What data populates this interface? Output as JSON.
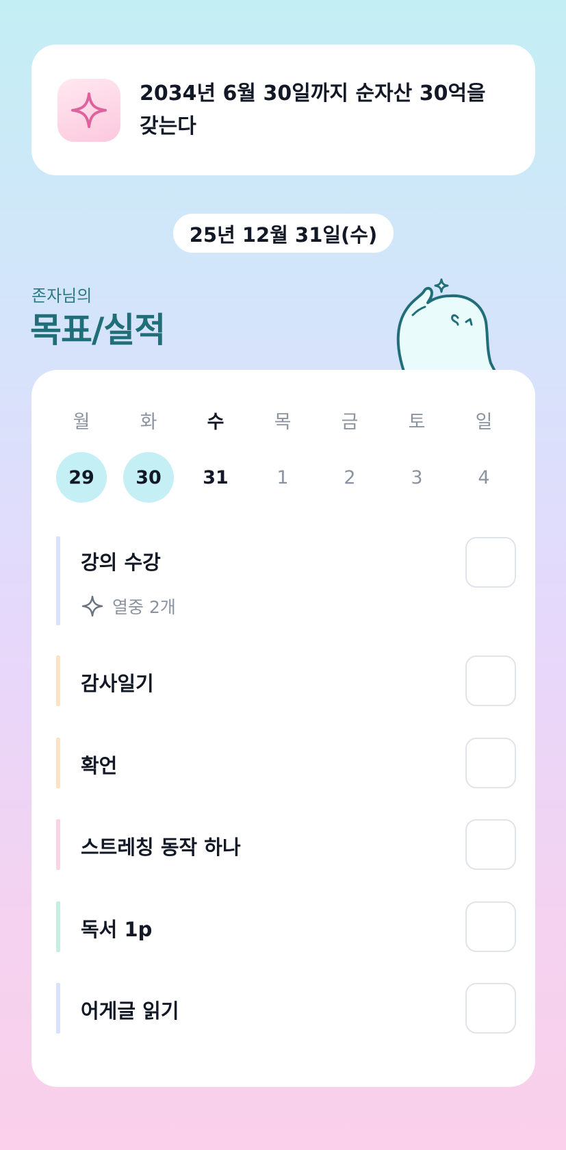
{
  "goal": {
    "text": "2034년 6월 30일까지 순자산 30억을 갖는다",
    "icon": "sparkle-icon"
  },
  "date": "25년 12월 31일(수)",
  "section": {
    "owner": "존자님의",
    "title": "목표/실적"
  },
  "week": [
    {
      "day": "월",
      "date": "29",
      "state": "done"
    },
    {
      "day": "화",
      "date": "30",
      "state": "done"
    },
    {
      "day": "수",
      "date": "31",
      "state": "today"
    },
    {
      "day": "목",
      "date": "1",
      "state": "future"
    },
    {
      "day": "금",
      "date": "2",
      "state": "future"
    },
    {
      "day": "토",
      "date": "3",
      "state": "future"
    },
    {
      "day": "일",
      "date": "4",
      "state": "future"
    }
  ],
  "tasks": [
    {
      "label": "강의 수강",
      "sub": "열중 2개",
      "color": "#d8e2fb",
      "checked": false
    },
    {
      "label": "감사일기",
      "color": "#fde3c4",
      "checked": false
    },
    {
      "label": "확언",
      "color": "#fde3c4",
      "checked": false
    },
    {
      "label": "스트레칭 동작 하나",
      "color": "#fbd3e6",
      "checked": false
    },
    {
      "label": "독서 1p",
      "color": "#c5f0e0",
      "checked": false
    },
    {
      "label": "어게글 읽기",
      "color": "#d8e2fb",
      "checked": false
    }
  ],
  "colors": {
    "accent_teal": "#1f6e78",
    "done_circle": "#c3eff5",
    "sparkle_pink": "#e0629d"
  }
}
